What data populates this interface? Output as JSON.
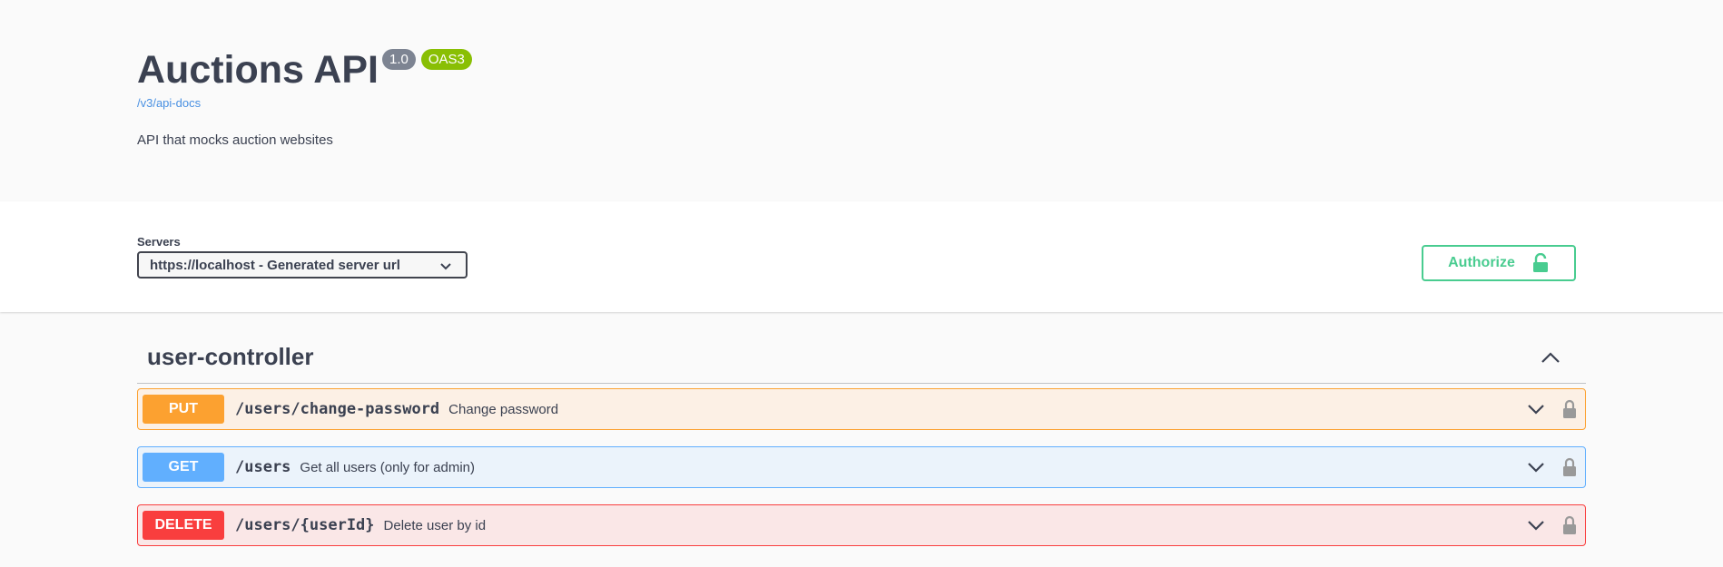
{
  "info": {
    "title": "Auctions API",
    "version": "1.0",
    "oas_badge": "OAS3",
    "docs_link": "/v3/api-docs",
    "description": "API that mocks auction websites"
  },
  "servers": {
    "label": "Servers",
    "selected": "https://localhost - Generated server url"
  },
  "authorize": {
    "label": "Authorize"
  },
  "tag": {
    "name": "user-controller"
  },
  "operations": [
    {
      "method": "PUT",
      "path": "/users/change-password",
      "summary": "Change password"
    },
    {
      "method": "GET",
      "path": "/users",
      "summary": "Get all users (only for admin)"
    },
    {
      "method": "DELETE",
      "path": "/users/{userId}",
      "summary": "Delete user by id"
    }
  ],
  "colors": {
    "put": "#fca130",
    "get": "#61affe",
    "delete": "#f93e3e",
    "authorize": "#49cc90",
    "oas_badge": "#89bf04",
    "version_badge": "#7d8492"
  },
  "icons": [
    "chevron-down-icon",
    "unlocked-padlock-icon",
    "chevron-up-icon",
    "lock-icon"
  ]
}
